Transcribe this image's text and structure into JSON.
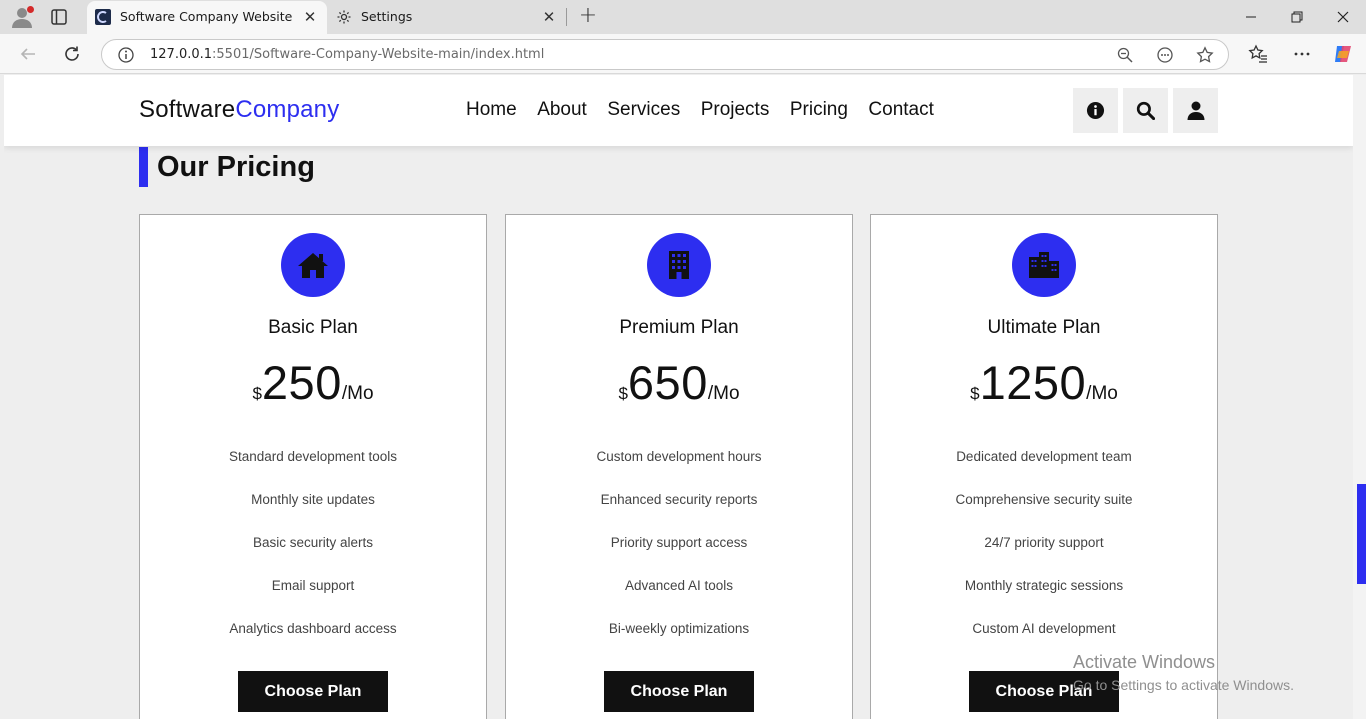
{
  "browser": {
    "tabs": [
      {
        "title": "Software Company Website",
        "active": true,
        "favicon": "site-favicon"
      },
      {
        "title": "Settings",
        "active": false,
        "favicon": "gear-icon"
      }
    ],
    "url_host": "127.0.0.1",
    "url_rest": ":5501/Software-Company-Website-main/index.html"
  },
  "site": {
    "logo_main": "Software",
    "logo_accent": "Company",
    "nav": [
      "Home",
      "About",
      "Services",
      "Projects",
      "Pricing",
      "Contact"
    ],
    "header_buttons": [
      "info-icon",
      "search-icon",
      "user-icon"
    ],
    "accent_color": "#2d2ef0"
  },
  "pricing": {
    "title": "Our Pricing",
    "plans": [
      {
        "name": "Basic Plan",
        "currency": "$",
        "amount": "250",
        "period": "/Mo",
        "icon": "home-icon",
        "features": [
          "Standard development tools",
          "Monthly site updates",
          "Basic security alerts",
          "Email support",
          "Analytics dashboard access"
        ],
        "button": "Choose Plan"
      },
      {
        "name": "Premium Plan",
        "currency": "$",
        "amount": "650",
        "period": "/Mo",
        "icon": "building-icon",
        "features": [
          "Custom development hours",
          "Enhanced security reports",
          "Priority support access",
          "Advanced AI tools",
          "Bi-weekly optimizations"
        ],
        "button": "Choose Plan"
      },
      {
        "name": "Ultimate Plan",
        "currency": "$",
        "amount": "1250",
        "period": "/Mo",
        "icon": "city-icon",
        "features": [
          "Dedicated development team",
          "Comprehensive security suite",
          "24/7 priority support",
          "Monthly strategic sessions",
          "Custom AI development"
        ],
        "button": "Choose Plan"
      }
    ]
  },
  "watermark": {
    "line1": "Activate Windows",
    "line2": "Go to Settings to activate Windows."
  }
}
